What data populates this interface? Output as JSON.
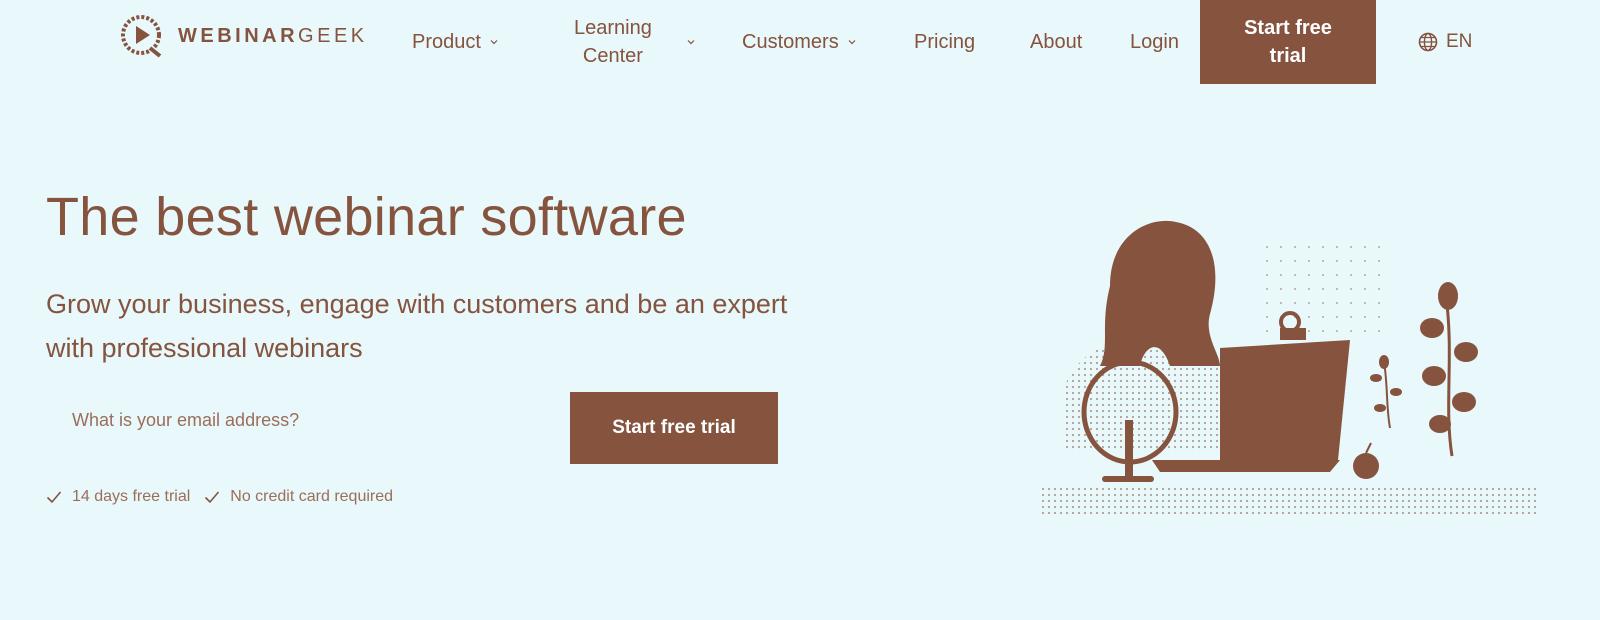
{
  "brand": {
    "name_bold": "WEBINAR",
    "name_light": "GEEK"
  },
  "nav": {
    "items": [
      {
        "label": "Product",
        "has_dropdown": true
      },
      {
        "label_line1": "Learning",
        "label_line2": "Center",
        "has_dropdown": true
      },
      {
        "label": "Customers",
        "has_dropdown": true
      },
      {
        "label": "Pricing",
        "has_dropdown": false
      },
      {
        "label": "About",
        "has_dropdown": false
      },
      {
        "label": "Login",
        "has_dropdown": false
      }
    ],
    "cta_line1": "Start free",
    "cta_line2": "trial",
    "language": "EN"
  },
  "hero": {
    "title": "The best webinar software",
    "subtitle": "Grow your business, engage with customers and be an expert with professional webinars",
    "email_placeholder": "What is your email address?",
    "email_value": "",
    "cta_label": "Start free trial",
    "perks": [
      "14 days free trial",
      "No credit card required"
    ]
  },
  "colors": {
    "background": "#e8f8fb",
    "brand": "#85533e",
    "button_text": "#ffffff"
  },
  "icons": [
    "webinargeek-logo-icon",
    "chevron-down-icon",
    "globe-icon",
    "check-icon"
  ]
}
